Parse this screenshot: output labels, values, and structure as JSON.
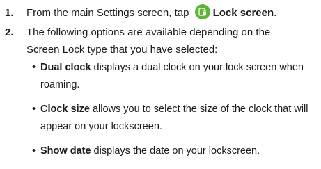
{
  "steps": [
    {
      "number": "1.",
      "text_before": "From the main Settings screen, tap",
      "icon": "lock-screen-settings-icon",
      "bold": "Lock screen",
      "text_after": "."
    },
    {
      "number": "2.",
      "line1": "The following options are available depending on the",
      "line2": "Screen Lock type that you have selected:"
    }
  ],
  "bullets": [
    {
      "marker": "•",
      "term": "Dual clock",
      "desc_line1": " displays a dual clock on your lock screen when",
      "desc_line2": "roaming."
    },
    {
      "marker": "•",
      "term": "Clock size",
      "desc_line1": " allows you to select the size of the clock that will",
      "desc_line2": "appear on your lockscreen."
    },
    {
      "marker": "•",
      "term": "Show date",
      "desc_line1": " displays the date on your lockscreen.",
      "desc_line2": ""
    }
  ],
  "colors": {
    "icon_background": "#5cb632",
    "text": "#1a1a1a"
  }
}
